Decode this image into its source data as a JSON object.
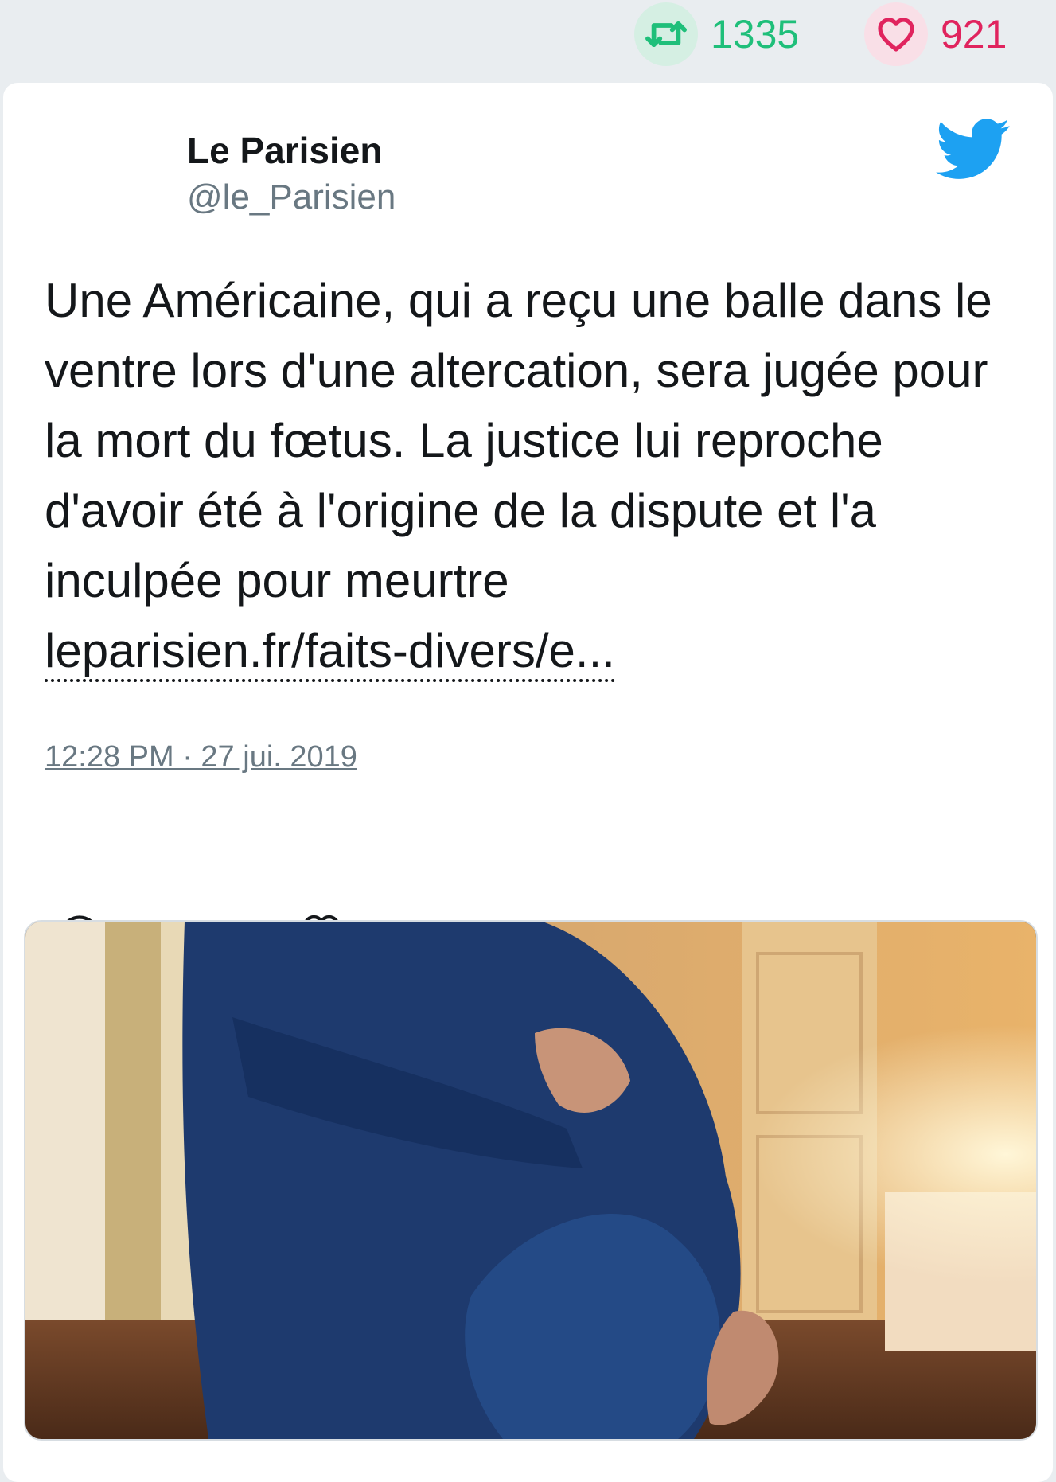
{
  "stats": {
    "retweet_count": "1335",
    "like_count": "921",
    "retweet_color": "#1fbf7a",
    "like_color": "#e0245e",
    "retweet_icon": "retweet-icon",
    "like_icon": "heart-icon"
  },
  "tweet": {
    "author_name": "Le Parisien",
    "author_handle": "@le_Parisien",
    "brand_icon": "twitter-bird-icon",
    "brand_color": "#1da1f2",
    "text": "Une Américaine, qui a reçu une balle dans le ventre lors d'une altercation, sera jugée pour la mort du fœtus. La justice lui reproche d'avoir été à l'origine de la dispute et l'a inculpée pour meurtre ",
    "link_text": "leparisien.fr/faits-divers/e...",
    "timestamp": "12:28 PM · 27 jui. 2019",
    "actions": [
      "reply-icon",
      "retweet-icon",
      "like-icon"
    ]
  }
}
